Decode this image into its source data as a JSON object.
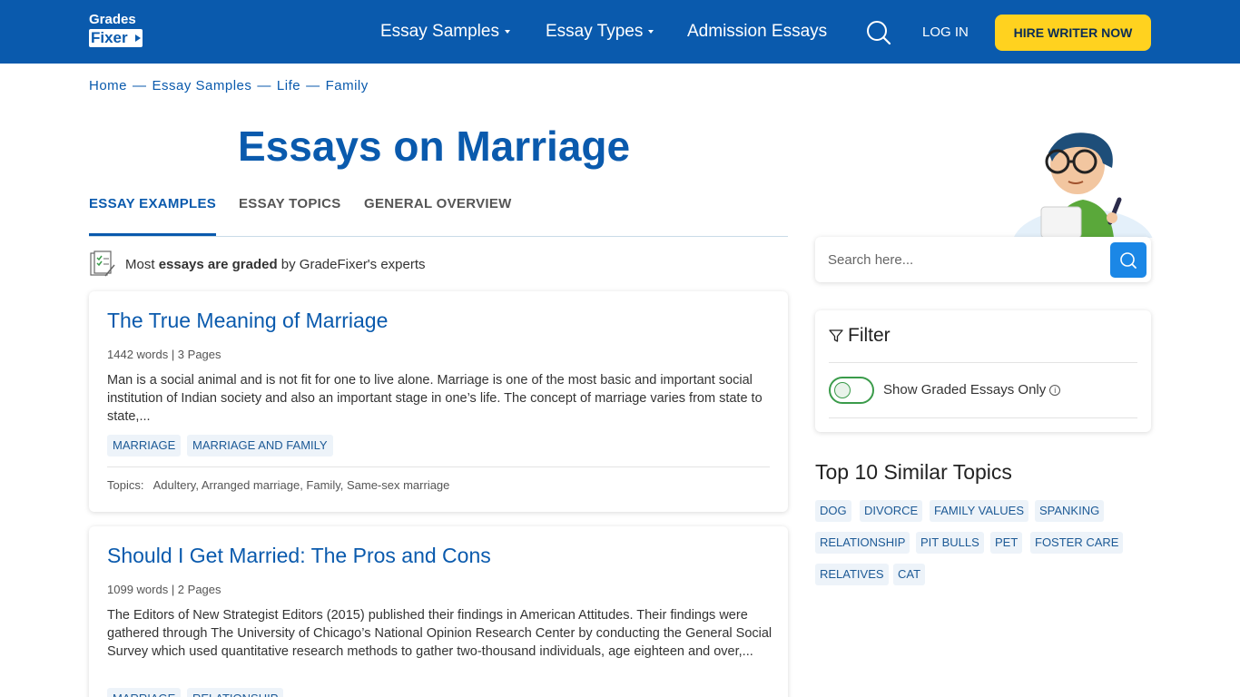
{
  "header": {
    "logo_top": "Grades",
    "logo_bottom": "Fixer",
    "nav": [
      {
        "label": "Essay Samples",
        "dropdown": true
      },
      {
        "label": "Essay Types",
        "dropdown": true
      },
      {
        "label": "Admission Essays",
        "dropdown": false
      }
    ],
    "login": "LOG IN",
    "hire": "HIRE WRITER NOW"
  },
  "breadcrumb": [
    "Home",
    "Essay Samples",
    "Life",
    "Family"
  ],
  "breadcrumb_sep": "—",
  "page_title": "Essays on Marriage",
  "tabs": [
    "ESSAY EXAMPLES",
    "ESSAY TOPICS",
    "GENERAL OVERVIEW"
  ],
  "graded_note": {
    "pre": "Most ",
    "bold": "essays are graded",
    "post": " by GradeFixer's experts"
  },
  "essays": [
    {
      "title": "The True Meaning of Marriage",
      "meta": "1442 words | 3 Pages",
      "excerpt": "Man is a social animal and is not fit for one to live alone. Marriage is one of the most basic and important social institution of Indian society and also an important stage in one’s life. The concept of marriage varies from state to state,...",
      "tags": [
        "MARRIAGE",
        "MARRIAGE AND FAMILY"
      ],
      "topics_label": "Topics:",
      "topics": "Adultery, Arranged marriage, Family, Same-sex marriage"
    },
    {
      "title": "Should I Get Married: The Pros and Cons",
      "meta": "1099 words | 2 Pages",
      "excerpt": "The Editors of New Strategist Editors (2015) published their findings in American Attitudes. Their findings were gathered through The University of Chicago’s National Opinion Research Center by conducting the General Social Survey which used quantitative research methods to gather two-thousand individuals, age eighteen and over,...",
      "tags": [
        "MARRIAGE",
        "RELATIONSHIP"
      ]
    }
  ],
  "sidebar": {
    "search_placeholder": "Search here...",
    "filter_title": "Filter",
    "toggle_label": "Show Graded Essays Only",
    "similar_title": "Top 10 Similar Topics",
    "similar_topics": [
      "DOG",
      "DIVORCE",
      "FAMILY VALUES",
      "SPANKING",
      "RELATIONSHIP",
      "PIT BULLS",
      "PET",
      "FOSTER CARE",
      "RELATIVES",
      "CAT"
    ]
  },
  "colors": {
    "brand": "#0a5aad",
    "accent": "#ffd21f",
    "search_button": "#1b87e6",
    "toggle": "#3a9b4a"
  }
}
